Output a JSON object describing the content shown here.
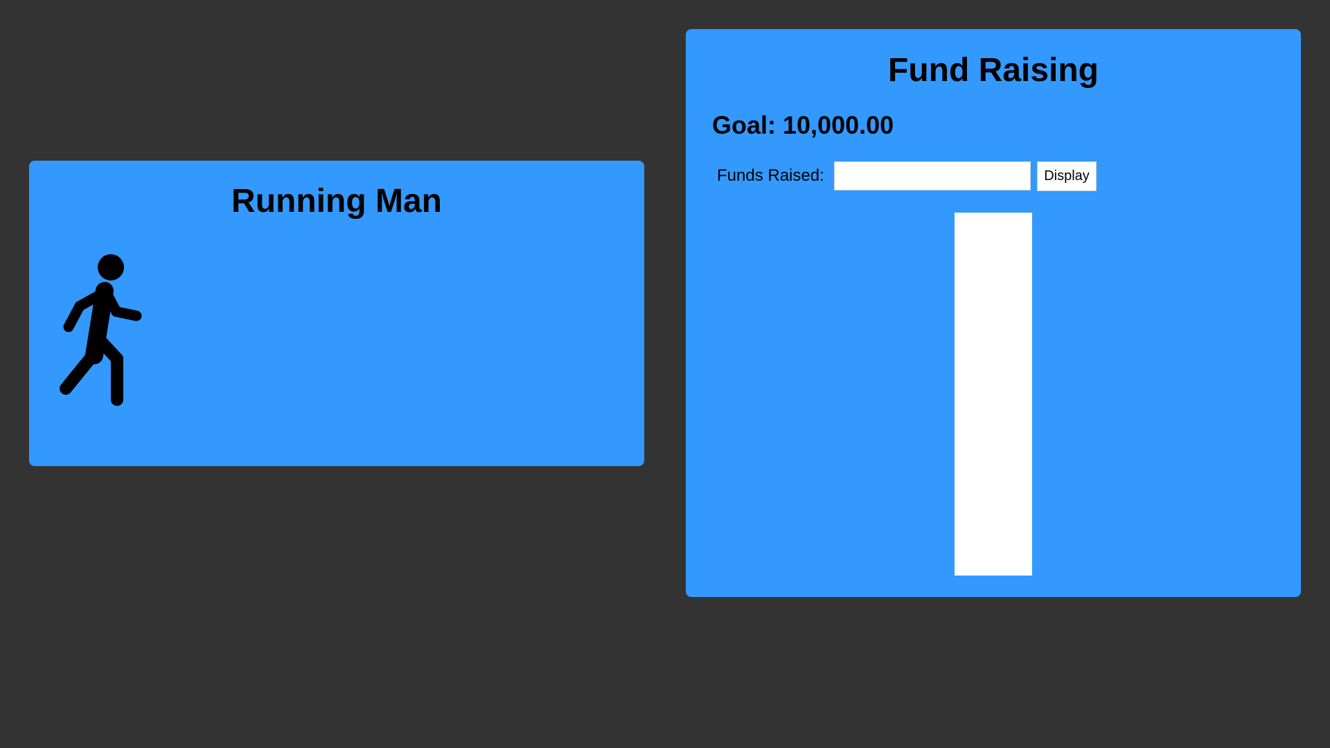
{
  "running_man": {
    "title": "Running Man",
    "icon": "walking-person-icon"
  },
  "fund_raising": {
    "title": "Fund Raising",
    "goal_label": "Goal: ",
    "goal_value": "10,000.00",
    "funds_label": "Funds Raised:",
    "funds_input_value": "",
    "funds_input_placeholder": "",
    "display_button_label": "Display",
    "progress_fraction": 0
  },
  "colors": {
    "background": "#333333",
    "panel": "#3399ff",
    "text": "#000000",
    "thermometer": "#ffffff"
  }
}
